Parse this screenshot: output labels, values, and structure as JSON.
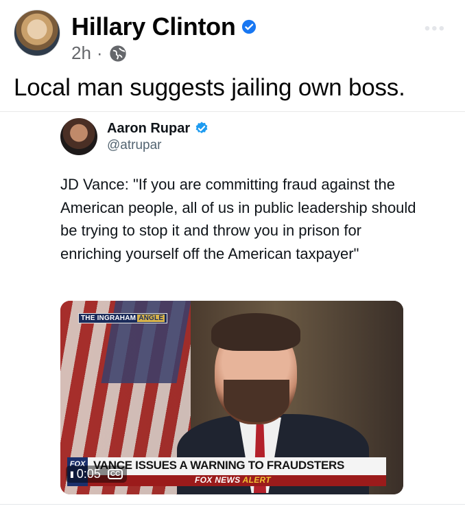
{
  "post": {
    "author": "Hillary Clinton",
    "time": "2h",
    "separator": "·",
    "caption": "Local man suggests jailing own boss.",
    "more": "•••"
  },
  "tweet": {
    "name": "Aaron Rupar",
    "handle": "@atrupar",
    "text": "JD Vance: \"If you are committing fraud against the American people, all of us in public leadership should be trying to stop it and throw you in prison for enriching yourself off the American taxpayer\""
  },
  "video": {
    "show_name": "THE INGRAHAM",
    "show_name_2": "ANGLE",
    "headline": "VANCE ISSUES A WARNING TO FRAUDSTERS",
    "alert_prefix": "FOX NEWS",
    "alert_word": "ALERT",
    "time": "0:05",
    "pause": "II",
    "cc": "CC",
    "logo": "FOX"
  },
  "colors": {
    "verified": "#1877f2",
    "twitter_verified": "#1d9bf0",
    "text_secondary": "#65676b"
  },
  "icons": {
    "verified": "verified-badge-icon",
    "privacy": "globe-icon",
    "pause": "pause-icon",
    "captions": "cc-icon"
  }
}
